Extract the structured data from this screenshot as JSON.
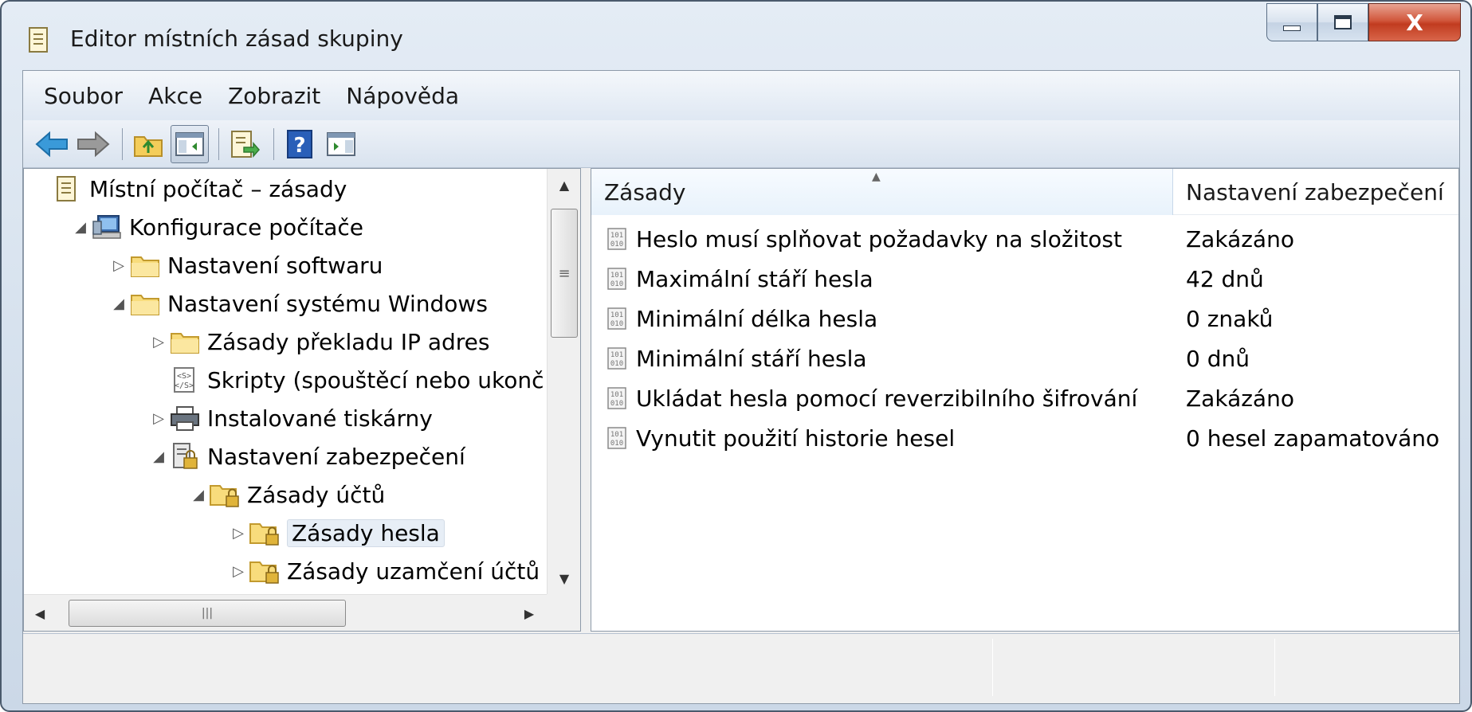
{
  "window": {
    "title": "Editor místních zásad skupiny"
  },
  "menubar": {
    "items": [
      "Soubor",
      "Akce",
      "Zobrazit",
      "Nápověda"
    ]
  },
  "caption": {
    "close": "X"
  },
  "tree": {
    "items": [
      {
        "label": "Místní počítač – zásady",
        "level": 0,
        "arrow": "",
        "icon": "policy-document-icon"
      },
      {
        "label": "Konfigurace počítače",
        "level": 1,
        "arrow": "◢",
        "icon": "computer-icon"
      },
      {
        "label": "Nastavení softwaru",
        "level": 2,
        "arrow": "▷",
        "icon": "folder-icon"
      },
      {
        "label": "Nastavení systému Windows",
        "level": 2,
        "arrow": "◢",
        "icon": "folder-icon"
      },
      {
        "label": "Zásady překladu IP adres",
        "level": 3,
        "arrow": "▷",
        "icon": "folder-icon"
      },
      {
        "label": "Skripty (spouštěcí nebo ukonč",
        "level": 3,
        "arrow": "",
        "icon": "script-icon"
      },
      {
        "label": "Instalované tiskárny",
        "level": 3,
        "arrow": "▷",
        "icon": "printer-icon"
      },
      {
        "label": "Nastavení zabezpečení",
        "level": 3,
        "arrow": "◢",
        "icon": "security-settings-icon"
      },
      {
        "label": "Zásady účtů",
        "level": 4,
        "arrow": "◢",
        "icon": "locked-folder-icon"
      },
      {
        "label": "Zásady hesla",
        "level": 5,
        "arrow": "▷",
        "icon": "locked-folder-icon",
        "selected": true
      },
      {
        "label": "Zásady uzamčení účtů",
        "level": 5,
        "arrow": "▷",
        "icon": "locked-folder-icon"
      }
    ]
  },
  "list": {
    "columns": [
      "Zásady",
      "Nastavení zabezpečení"
    ],
    "rows": [
      {
        "policy": "Heslo musí splňovat požadavky na složitost",
        "setting": "Zakázáno"
      },
      {
        "policy": "Maximální stáří hesla",
        "setting": "42 dnů"
      },
      {
        "policy": "Minimální délka hesla",
        "setting": "0 znaků"
      },
      {
        "policy": "Minimální stáří hesla",
        "setting": "0 dnů"
      },
      {
        "policy": "Ukládat hesla pomocí reverzibilního šifrování",
        "setting": "Zakázáno"
      },
      {
        "policy": "Vynutit použití historie hesel",
        "setting": "0 hesel zapamatováno"
      }
    ]
  },
  "colors": {
    "selection": "#e7eef6",
    "header_sorted": "#e8f2fb",
    "close": "#c13b1f"
  }
}
